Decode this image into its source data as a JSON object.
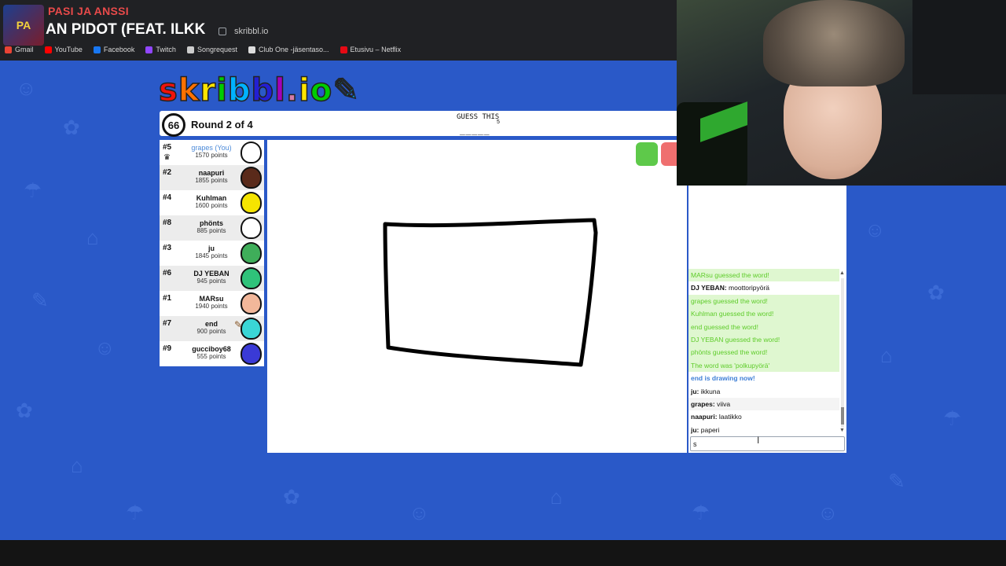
{
  "now_playing": {
    "artist": "PASI JA ANSSI",
    "title": "AN PIDOT (FEAT. ILKK",
    "art_text": "PA"
  },
  "browser": {
    "url": "skribbl.io",
    "bookmarks": [
      {
        "label": "Gmail",
        "color": "#ea4335"
      },
      {
        "label": "YouTube",
        "color": "#ff0000"
      },
      {
        "label": "Facebook",
        "color": "#1877f2"
      },
      {
        "label": "Twitch",
        "color": "#9146ff"
      },
      {
        "label": "Songrequest",
        "color": "#cccccc"
      },
      {
        "label": "Club One -jäsentaso...",
        "color": "#dddddd"
      },
      {
        "label": "Etusivu – Netflix",
        "color": "#e50914"
      }
    ]
  },
  "game": {
    "logo": [
      "s",
      "k",
      "r",
      "i",
      "b",
      "b",
      "l",
      ".",
      "i",
      "o",
      "✎"
    ],
    "timer": "66",
    "round": "Round 2 of 4",
    "guess_label": "GUESS THIS",
    "word_length": "5",
    "word_blanks": "_____",
    "players": [
      {
        "rank": "#5",
        "name": "grapes (You)",
        "points": "1570 points",
        "avatar_color": "#ffffff",
        "me": true,
        "crown": true
      },
      {
        "rank": "#2",
        "name": "naapuri",
        "points": "1855 points",
        "avatar_color": "#5a2a1a"
      },
      {
        "rank": "#4",
        "name": "Kuhlman",
        "points": "1600 points",
        "avatar_color": "#f5e400"
      },
      {
        "rank": "#8",
        "name": "phönts",
        "points": "885 points",
        "avatar_color": "#ffffff"
      },
      {
        "rank": "#3",
        "name": "ju",
        "points": "1845 points",
        "avatar_color": "#3fae5a"
      },
      {
        "rank": "#6",
        "name": "DJ YEBAN",
        "points": "945 points",
        "avatar_color": "#2fc27a"
      },
      {
        "rank": "#1",
        "name": "MARsu",
        "points": "1940 points",
        "avatar_color": "#f2b79a"
      },
      {
        "rank": "#7",
        "name": "end",
        "points": "900 points",
        "avatar_color": "#3ad6d6",
        "drawing": true
      },
      {
        "rank": "#9",
        "name": "gucciboy68",
        "points": "555 points",
        "avatar_color": "#3a3ad6"
      }
    ]
  },
  "chat": {
    "messages": [
      {
        "type": "green",
        "text": "MARsu guessed the word!"
      },
      {
        "type": "user",
        "user": "DJ YEBAN:",
        "text": "moottoripyörä"
      },
      {
        "type": "green",
        "text": "grapes guessed the word!"
      },
      {
        "type": "green",
        "text": "Kuhlman guessed the word!"
      },
      {
        "type": "green",
        "text": "end guessed the word!"
      },
      {
        "type": "green",
        "text": "DJ YEBAN guessed the word!"
      },
      {
        "type": "green",
        "text": "phönts guessed the word!"
      },
      {
        "type": "green",
        "text": "The word was 'polkupyörä'"
      },
      {
        "type": "blue",
        "text": "end is drawing now!"
      },
      {
        "type": "user",
        "user": "ju:",
        "text": "ikkuna"
      },
      {
        "type": "user-odd",
        "user": "grapes:",
        "text": "viiva"
      },
      {
        "type": "user",
        "user": "naapuri:",
        "text": "laatikko"
      },
      {
        "type": "user",
        "user": "ju:",
        "text": "paperi"
      }
    ],
    "input_value": "s"
  }
}
